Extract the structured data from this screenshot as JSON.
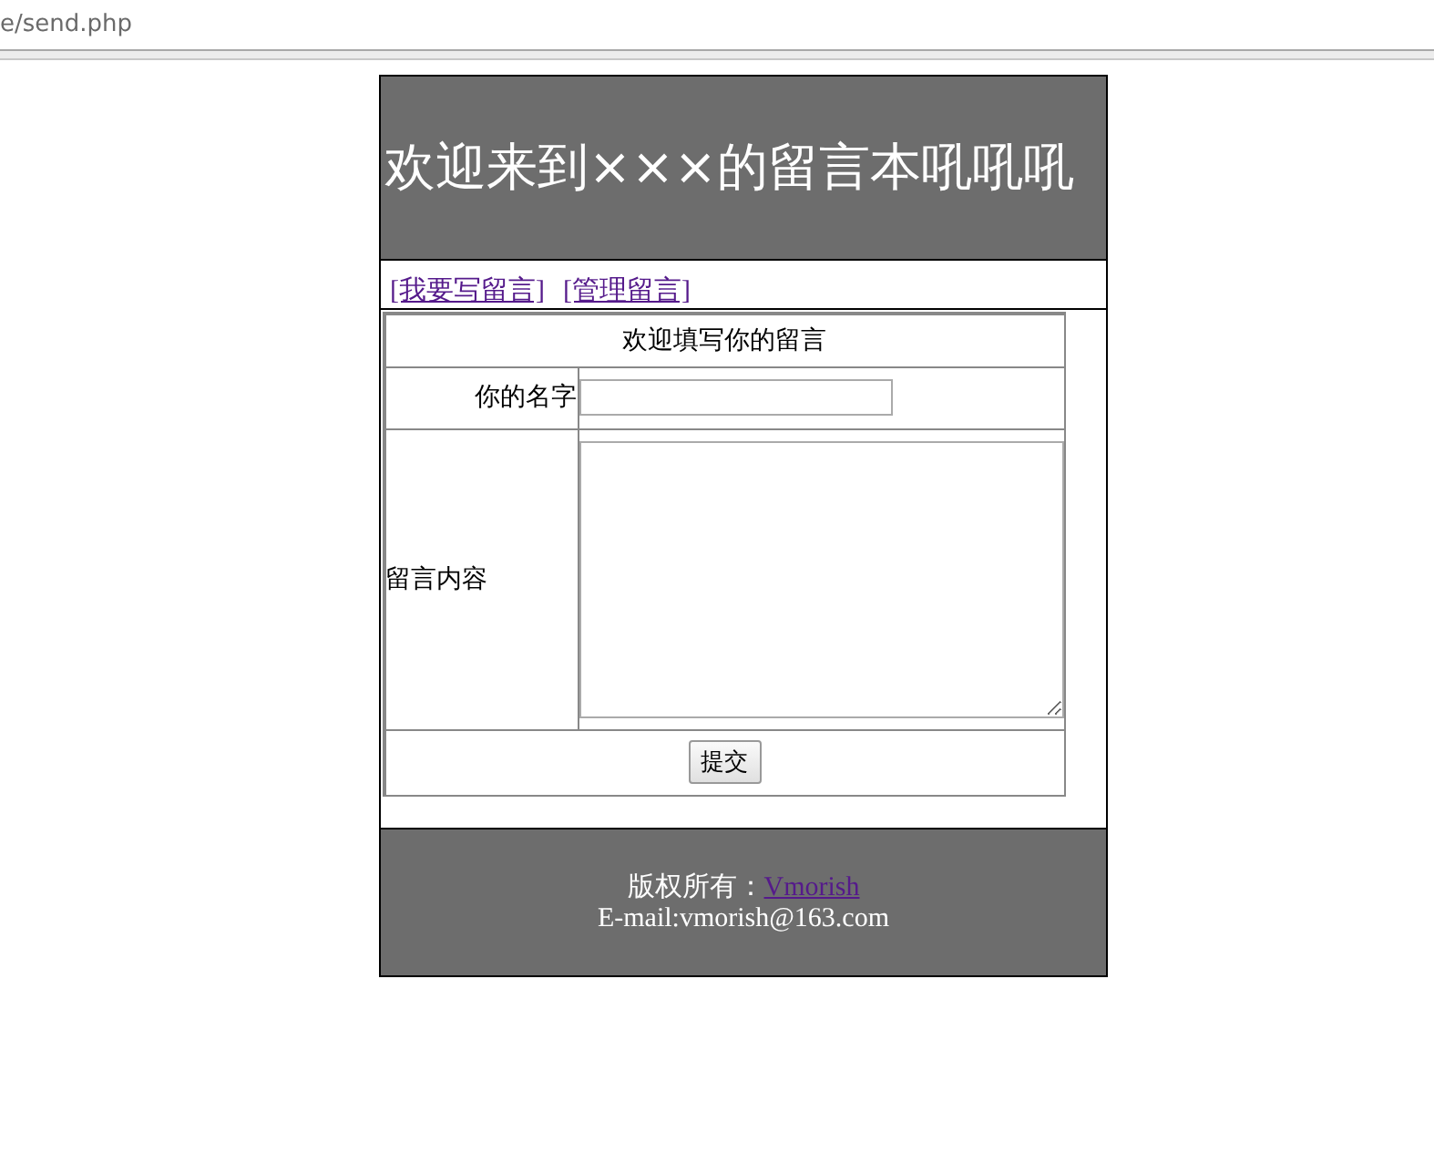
{
  "address_bar": {
    "url": "e/send.php"
  },
  "header": {
    "title": "欢迎来到×××的留言本吼吼吼"
  },
  "nav_links": [
    "[我要写留言]",
    "[管理留言]"
  ],
  "form": {
    "heading": "欢迎填写你的留言",
    "name_label": "你的名字",
    "content_label": "留言内容",
    "submit": "提交"
  },
  "footer": {
    "copyright": "版权所有：",
    "author_link": "Vmorish",
    "email": "E-mail:vmorish@163.com"
  }
}
